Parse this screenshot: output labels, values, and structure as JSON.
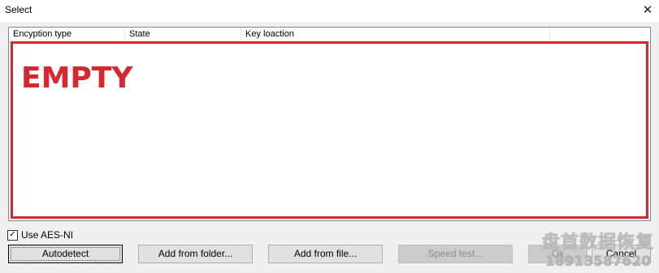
{
  "window": {
    "title": "Select",
    "close_glyph": "✕"
  },
  "list": {
    "columns": [
      "Encyption type",
      "State",
      "Key loaction",
      ""
    ],
    "empty_label": "EMPTY"
  },
  "options": {
    "aes_ni": {
      "label": "Use AES-NI",
      "checked": true,
      "check_glyph": "✓"
    }
  },
  "buttons": {
    "autodetect": "Autodetect",
    "add_folder": "Add from folder...",
    "add_file": "Add from file...",
    "speed_test": "Speed test...",
    "ok": "Ok",
    "cancel": "Cancel"
  },
  "watermark": {
    "line1": "盘首数据恢复",
    "line2": "18913587620"
  },
  "colors": {
    "highlight": "#d9262f",
    "window_bg": "#f0f0f0"
  }
}
